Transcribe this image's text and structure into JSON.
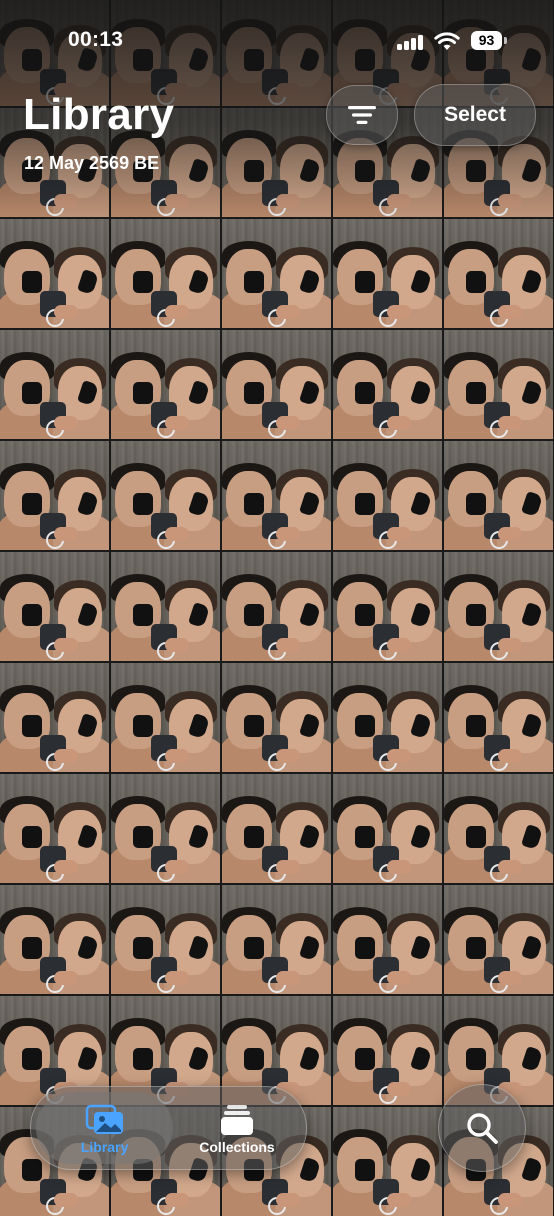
{
  "status_bar": {
    "time": "00:13",
    "battery_percent": "93"
  },
  "header": {
    "title": "Library",
    "date": "12 May 2569 BE",
    "select_label": "Select",
    "sort_icon": "sort-lines-icon"
  },
  "tabs": {
    "library_label": "Library",
    "library_icon": "photo-library-icon",
    "collections_label": "Collections",
    "collections_icon": "collections-stack-icon",
    "active": "library"
  },
  "search": {
    "icon": "magnifier-icon"
  },
  "grid": {
    "columns": 5,
    "photo_count": 55
  },
  "colors": {
    "accent": "#4aa3ff",
    "text": "#ffffff"
  }
}
